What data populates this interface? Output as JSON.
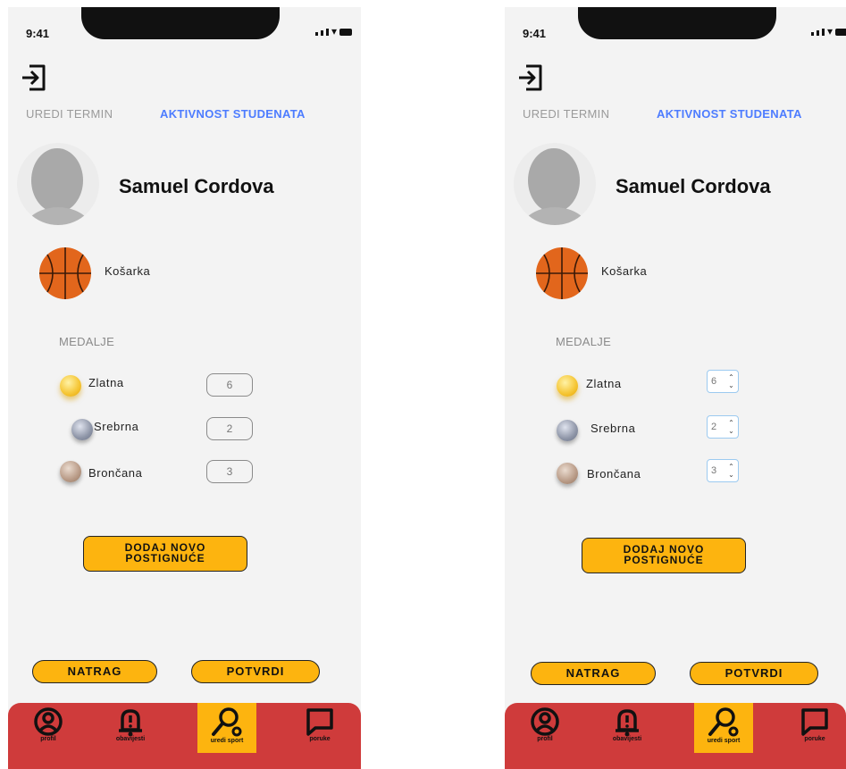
{
  "status": {
    "time": "9:41"
  },
  "tabs": {
    "edit": "UREDI TERMIN",
    "activity": "AKTIVNOST STUDENATA"
  },
  "profile": {
    "name": "Samuel Cordova",
    "sport": "Košarka"
  },
  "medals": {
    "title": "MEDALJE",
    "gold": {
      "label": "Zlatna",
      "count": "6"
    },
    "silver": {
      "label": "Srebrna",
      "count": "2"
    },
    "bronze": {
      "label": "Brončana",
      "count": "3"
    }
  },
  "buttons": {
    "add_line1": "DODAJ NOVO",
    "add_line2": "POSTIGNUĆE",
    "back": "NATRAG",
    "confirm": "POTVRDI"
  },
  "nav": {
    "profile": "profil",
    "notifications": "obavijesti",
    "edit_sport": "uredi sport",
    "messages": "poruke",
    "active": "edit_sport"
  },
  "colors": {
    "accent": "#fdb40f",
    "nav_bar": "#cf3b3b",
    "link": "#4d7cff"
  }
}
